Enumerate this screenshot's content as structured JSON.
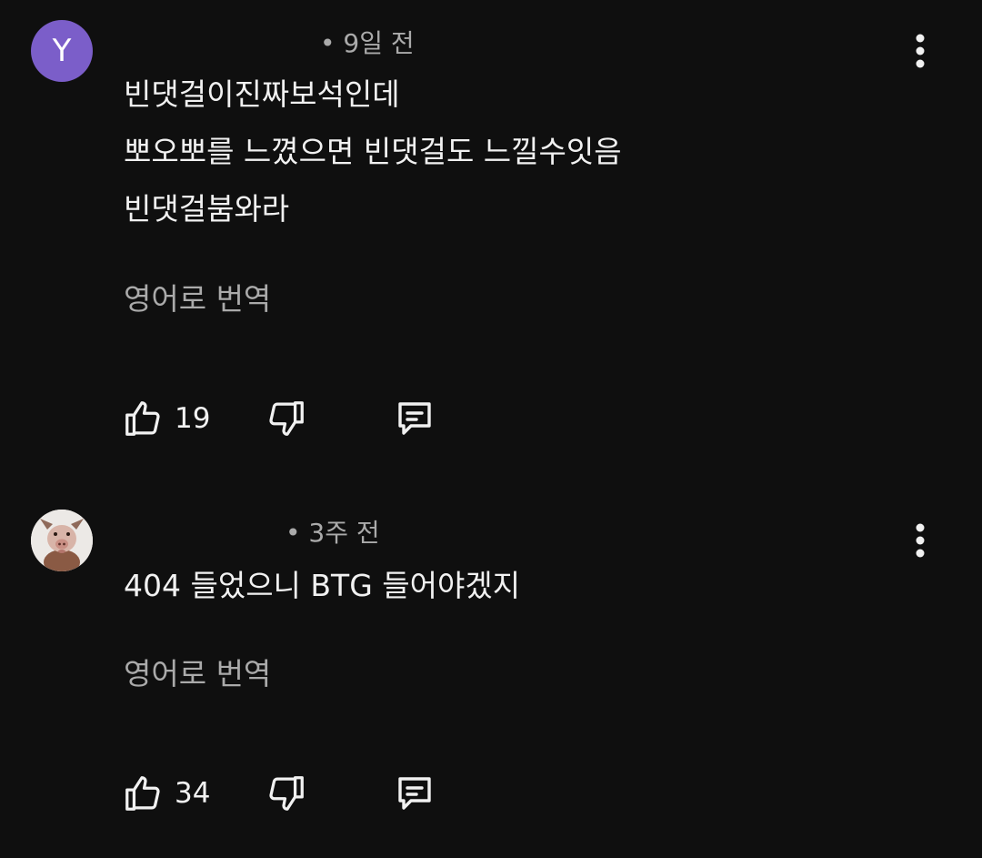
{
  "comments": [
    {
      "avatar_letter": "Y",
      "avatar_color": "#7b5ec9",
      "timestamp": "• 9일 전",
      "lines": [
        "빈댓걸이진짜보석인데",
        "뽀오뽀를 느꼈으면 빈댓걸도 느낄수잇음",
        "빈댓걸붐와라"
      ],
      "translate_label": "영어로 번역",
      "like_count": "19",
      "icons": {
        "like": "thumbs-up-icon",
        "dislike": "thumbs-down-icon",
        "reply": "reply-icon",
        "menu": "more-vertical-icon"
      }
    },
    {
      "avatar_icon": "pig-avatar",
      "timestamp": "• 3주 전",
      "lines": [
        "404 들었으니 BTG 들어야겠지"
      ],
      "translate_label": "영어로 번역",
      "like_count": "34",
      "icons": {
        "like": "thumbs-up-icon",
        "dislike": "thumbs-down-icon",
        "reply": "reply-icon",
        "menu": "more-vertical-icon"
      }
    }
  ]
}
